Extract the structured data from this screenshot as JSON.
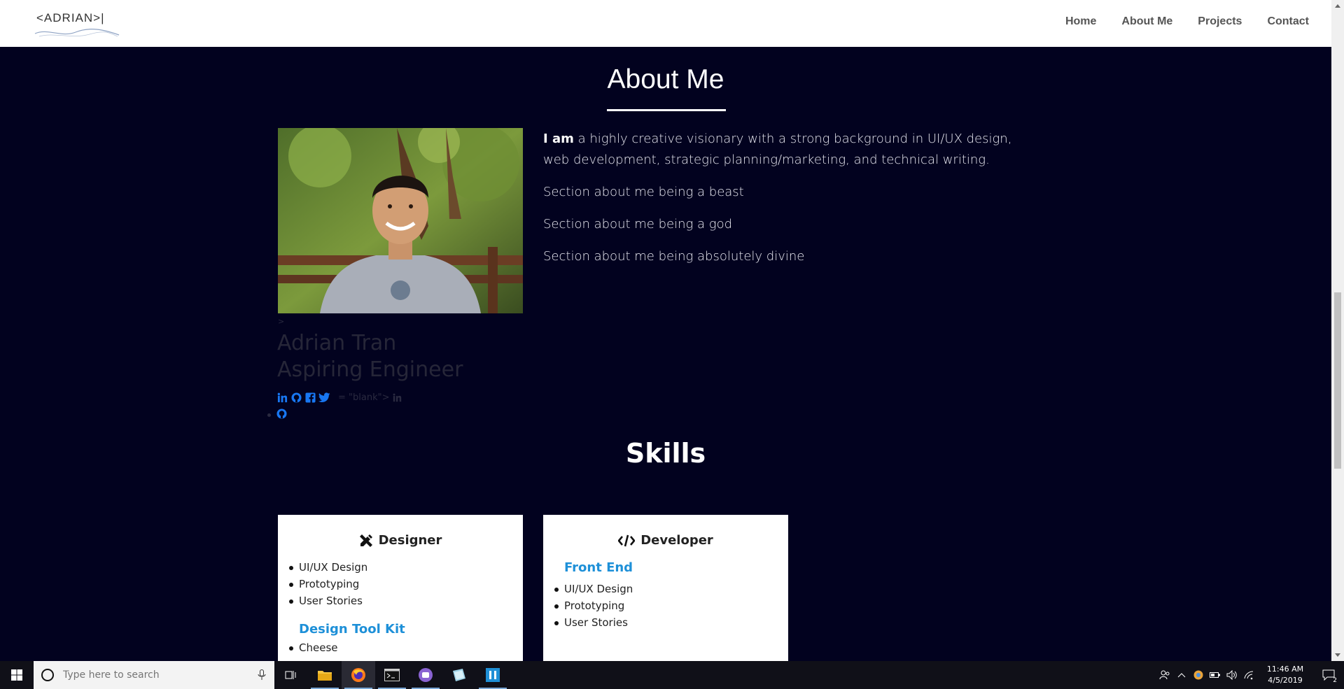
{
  "nav": {
    "logo_text": "<ADRIAN>|",
    "links": [
      "Home",
      "About Me",
      "Projects",
      "Contact"
    ]
  },
  "about": {
    "title": "About Me",
    "bio_lead": "I am",
    "bio_rest": " a highly creative visionary with a strong background in UI/UX design, web development, strategic planning/marketing, and technical writing.",
    "paragraphs": [
      "Section about me being a beast",
      "Section about me being a god",
      "Section about me being absolutely divine"
    ],
    "stray_gt": ">",
    "name": "Adrian Tran",
    "role": "Aspiring Engineer",
    "stray_code": "= \"blank\">"
  },
  "skills": {
    "title": "Skills",
    "designer": {
      "title": "Designer",
      "items": [
        "UI/UX Design",
        "Prototyping",
        "User Stories"
      ],
      "subheading": "Design Tool Kit",
      "sub_items": [
        "Cheese"
      ]
    },
    "developer": {
      "title": "Developer",
      "subheading": "Front End",
      "items": [
        "UI/UX Design",
        "Prototyping",
        "User Stories"
      ]
    }
  },
  "taskbar": {
    "search_placeholder": "Type here to search",
    "time": "11:46 AM",
    "date": "4/5/2019",
    "notification_count": "2"
  },
  "colors": {
    "background": "#02021f",
    "accent": "#1e90d8",
    "social_blue": "#1877f2"
  }
}
